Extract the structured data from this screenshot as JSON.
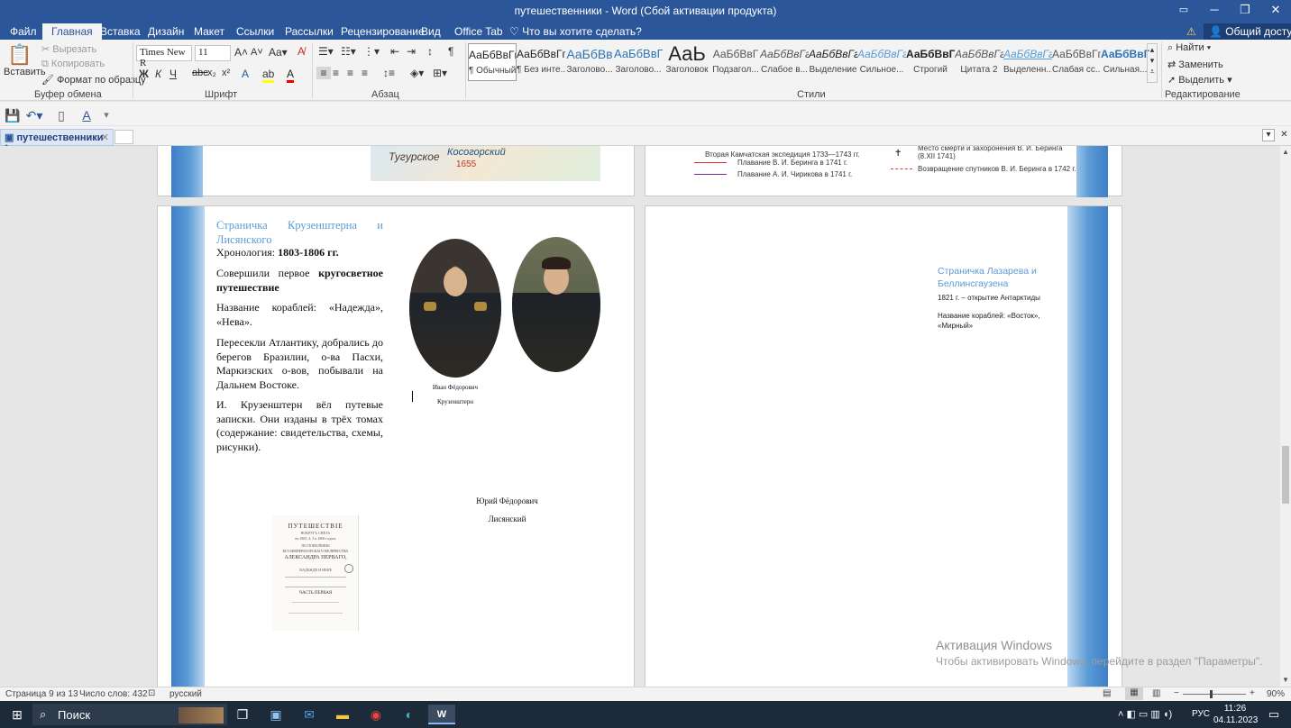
{
  "window": {
    "title": "путешественники - Word (Сбой активации продукта)"
  },
  "tabs": [
    "Файл",
    "Главная",
    "Вставка",
    "Дизайн",
    "Макет",
    "Ссылки",
    "Рассылки",
    "Рецензирование",
    "Вид",
    "Office Tab"
  ],
  "tell_me": "Что вы хотите сделать?",
  "share": "Общий доступ",
  "clipboard": {
    "paste": "Вставить",
    "cut": "Вырезать",
    "copy": "Копировать",
    "format": "Формат по образцу",
    "label": "Буфер обмена"
  },
  "font": {
    "name": "Times New R",
    "size": "11",
    "label": "Шрифт",
    "bold": "Ж",
    "italic": "К",
    "underline": "Ч"
  },
  "paragraph": {
    "label": "Абзац"
  },
  "styles": {
    "label": "Стили",
    "items": [
      {
        "preview": "АаБбВвГг,",
        "name": "¶ Обычный"
      },
      {
        "preview": "АаБбВвГг,",
        "name": "¶ Без инте..."
      },
      {
        "preview": "АаБбВв",
        "name": "Заголово..."
      },
      {
        "preview": "АаБбВвГ",
        "name": "Заголово..."
      },
      {
        "preview": "АаЬ",
        "name": "Заголовок"
      },
      {
        "preview": "АаБбВвГ",
        "name": "Подзагол..."
      },
      {
        "preview": "АаБбВвГг",
        "name": "Слабое в..."
      },
      {
        "preview": "АаБбВвГг",
        "name": "Выделение"
      },
      {
        "preview": "АаБбВвГг",
        "name": "Сильное..."
      },
      {
        "preview": "АаБбВвГг,",
        "name": "Строгий"
      },
      {
        "preview": "АаБбВвГг",
        "name": "Цитата 2"
      },
      {
        "preview": "АаБбВвГг",
        "name": "Выделенн..."
      },
      {
        "preview": "АаБбВвГг,",
        "name": "Слабая сс..."
      },
      {
        "preview": "АаБбВвГг,",
        "name": "Сильная..."
      }
    ]
  },
  "editing": {
    "find": "Найти",
    "replace": "Заменить",
    "select": "Выделить",
    "label": "Редактирование"
  },
  "doctab": {
    "label": "путешественники *"
  },
  "top_pages": {
    "map_labels": [
      "Тугурское",
      "Косогорский",
      "1655"
    ],
    "legend": [
      "Вторая Камчатская экспедиция 1733—1743 гг.",
      "Плавание В. И. Беринга в 1741 г.",
      "Плавание А. И. Чирикова в 1741 г.",
      "Место смерти и захоронения В. И. Беринга (8.XII 1741)",
      "Возвращение спутников В. И. Беринга в 1742 г."
    ]
  },
  "page_left": {
    "heading": "Страничка Крузенштерна и Лисянского",
    "chron_label": "Хронология: ",
    "chron_value": "1803-1806 гг.",
    "p1_a": "Совершили первое ",
    "p1_b": "кругосветное путешествие",
    "p2": "Название кораблей: «Надежда», «Нева».",
    "p3": "Пересекли Атлантику, добрались до берегов Бразилии, о-ва Пасхи, Маркизских о-вов, побывали на Дальнем Востоке.",
    "p4": "И. Крузенштерн вёл путевые записки. Они изданы в трёх томах (содержание: свидетельства, схемы, рисунки).",
    "caption1_a": "Иван Фёдорович",
    "caption1_b": "Крузенштерн",
    "caption2_a": "Юрий Фёдорович",
    "caption2_b": "Лисянский",
    "book": {
      "title": "ПУТЕШЕСТВІЕ",
      "l1": "ВОКРУГЪ СВѢТА",
      "l2": "въ 1803, 4, 5 и 1806 годахъ",
      "l3": "ПО ПОВЕЛѢНІЮ",
      "l4": "ЕГО ИМПЕРАТОРСКАГО ВЕЛИЧЕСТВА",
      "l5": "АЛЕКСАНДРА ПЕРВАГО,",
      "l6": "НАДЕЖДѢ И НЕВѢ",
      "part": "ЧАСТЬ ПЕРВАЯ"
    }
  },
  "page_right": {
    "heading": "Страничка Лазарева и Беллинсгаузена",
    "line1": "1821 г. – открытие Антарктиды",
    "line2": "Название кораблей: «Восток», «Мирный»"
  },
  "watermark": {
    "title": "Активация Windows",
    "text": "Чтобы активировать Windows, перейдите в раздел \"Параметры\"."
  },
  "status": {
    "page": "Страница 9 из 13",
    "words": "Число слов: 432",
    "lang": "русский",
    "zoom": "90%"
  },
  "taskbar": {
    "search": "Поиск",
    "lang": "РУС",
    "time": "11:26",
    "date": "04.11.2023"
  },
  "colors": {
    "accent": "#2b579a",
    "band": "#5b9bd5",
    "heading": "#5b9bd5"
  }
}
